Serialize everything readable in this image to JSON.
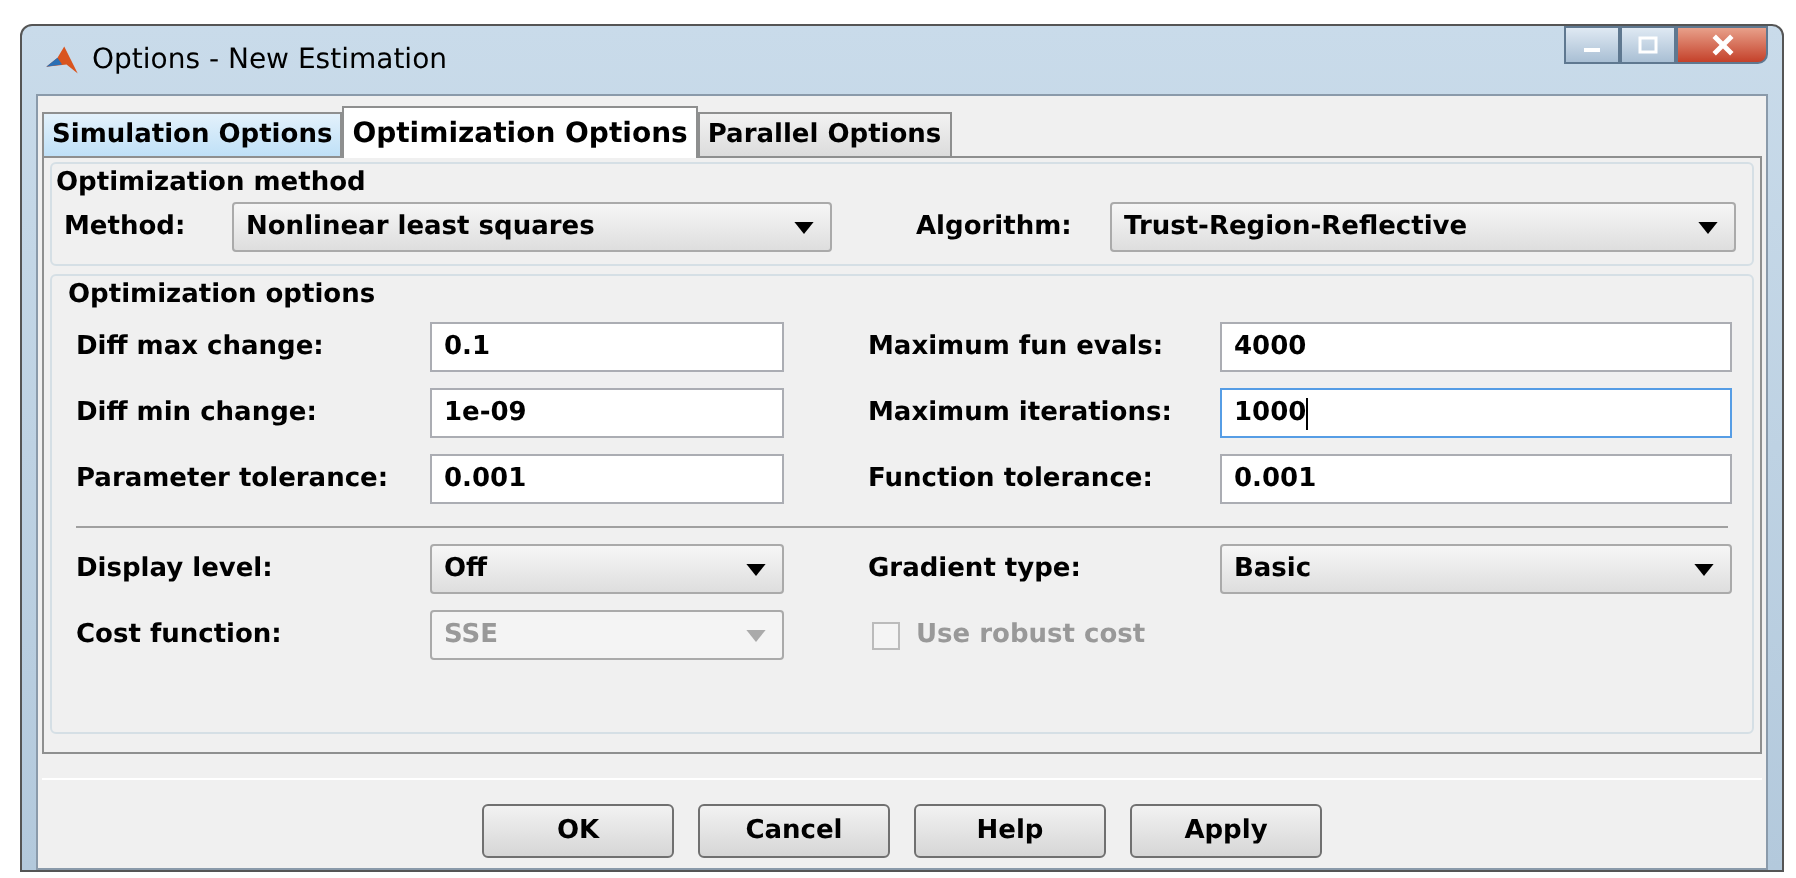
{
  "window": {
    "title": "Options - New Estimation"
  },
  "tabs": [
    {
      "label": "Simulation Options",
      "selected": false
    },
    {
      "label": "Optimization Options",
      "selected": true
    },
    {
      "label": "Parallel Options",
      "selected": false
    }
  ],
  "optimization_method": {
    "title": "Optimization method",
    "method": {
      "label": "Method:",
      "value": "Nonlinear least squares"
    },
    "algorithm": {
      "label": "Algorithm:",
      "value": "Trust-Region-Reflective"
    }
  },
  "optimization_options": {
    "title": "Optimization options",
    "fields": [
      {
        "label": "Diff max change:",
        "value": "0.1",
        "focused": false
      },
      {
        "label": "Maximum fun evals:",
        "value": "4000",
        "focused": false
      },
      {
        "label": "Diff min change:",
        "value": "1e-09",
        "focused": false
      },
      {
        "label": "Maximum iterations:",
        "value": "1000",
        "focused": true
      },
      {
        "label": "Parameter tolerance:",
        "value": "0.001",
        "focused": false
      },
      {
        "label": "Function tolerance:",
        "value": "0.001",
        "focused": false
      }
    ],
    "display_level": {
      "label": "Display level:",
      "value": "Off",
      "disabled": false
    },
    "gradient_type": {
      "label": "Gradient type:",
      "value": "Basic",
      "disabled": false
    },
    "cost_function": {
      "label": "Cost function:",
      "value": "SSE",
      "disabled": true
    },
    "robust_cost": {
      "label": "Use robust cost",
      "checked": false,
      "disabled": true
    }
  },
  "buttons": [
    "OK",
    "Cancel",
    "Help",
    "Apply"
  ]
}
